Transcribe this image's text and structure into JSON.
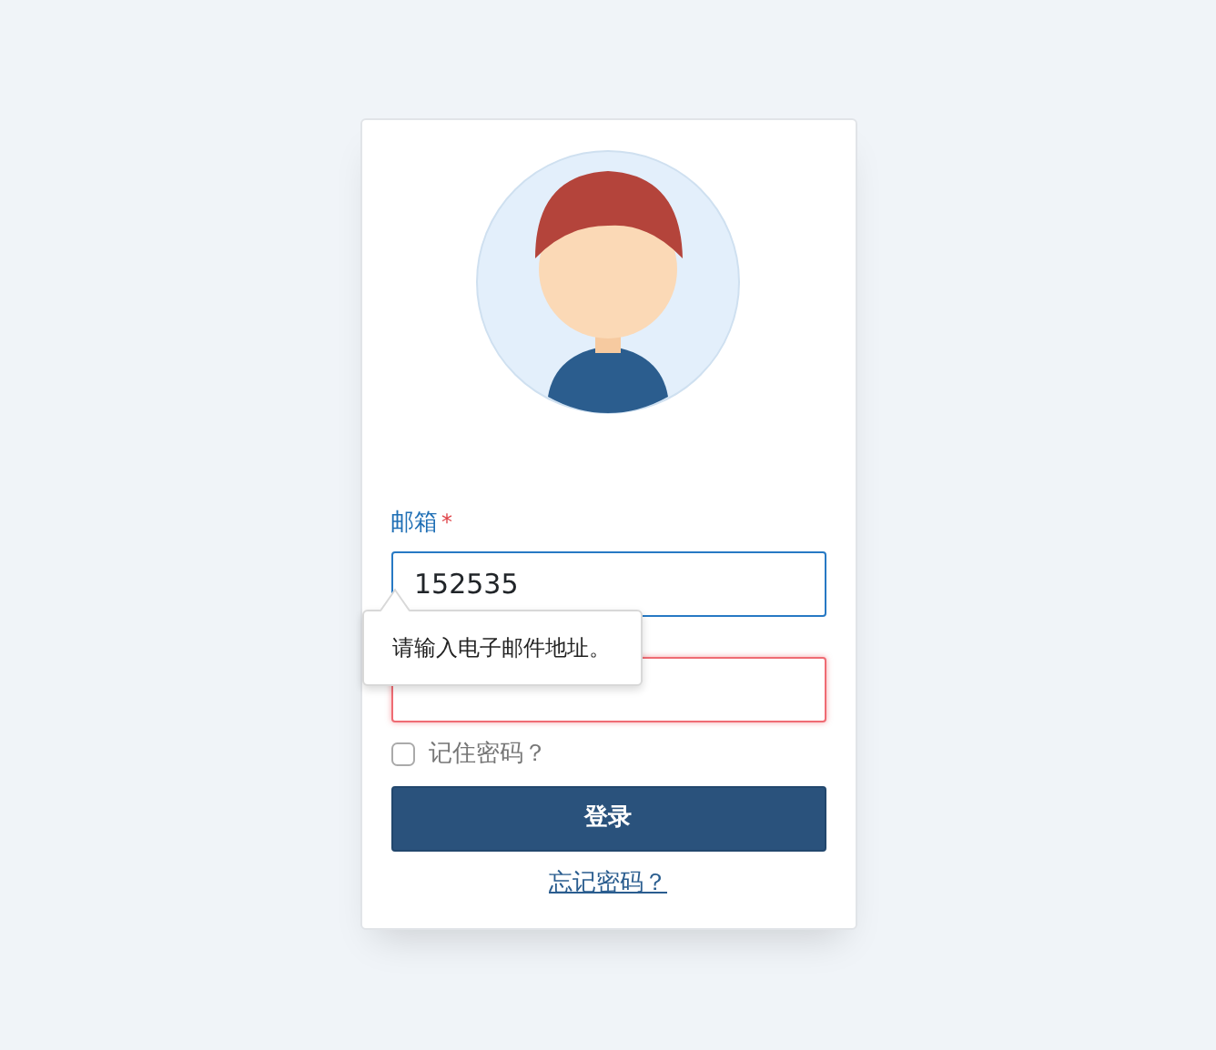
{
  "login_form": {
    "email": {
      "label": "邮箱",
      "required_mark": "*",
      "value": "152535",
      "focused": true
    },
    "password": {
      "invalid": true
    },
    "validation_tooltip": "请输入电子邮件地址。",
    "remember": {
      "label": "记住密码？",
      "checked": false
    },
    "submit_button": "登录",
    "forgot_link": "忘记密码？"
  }
}
